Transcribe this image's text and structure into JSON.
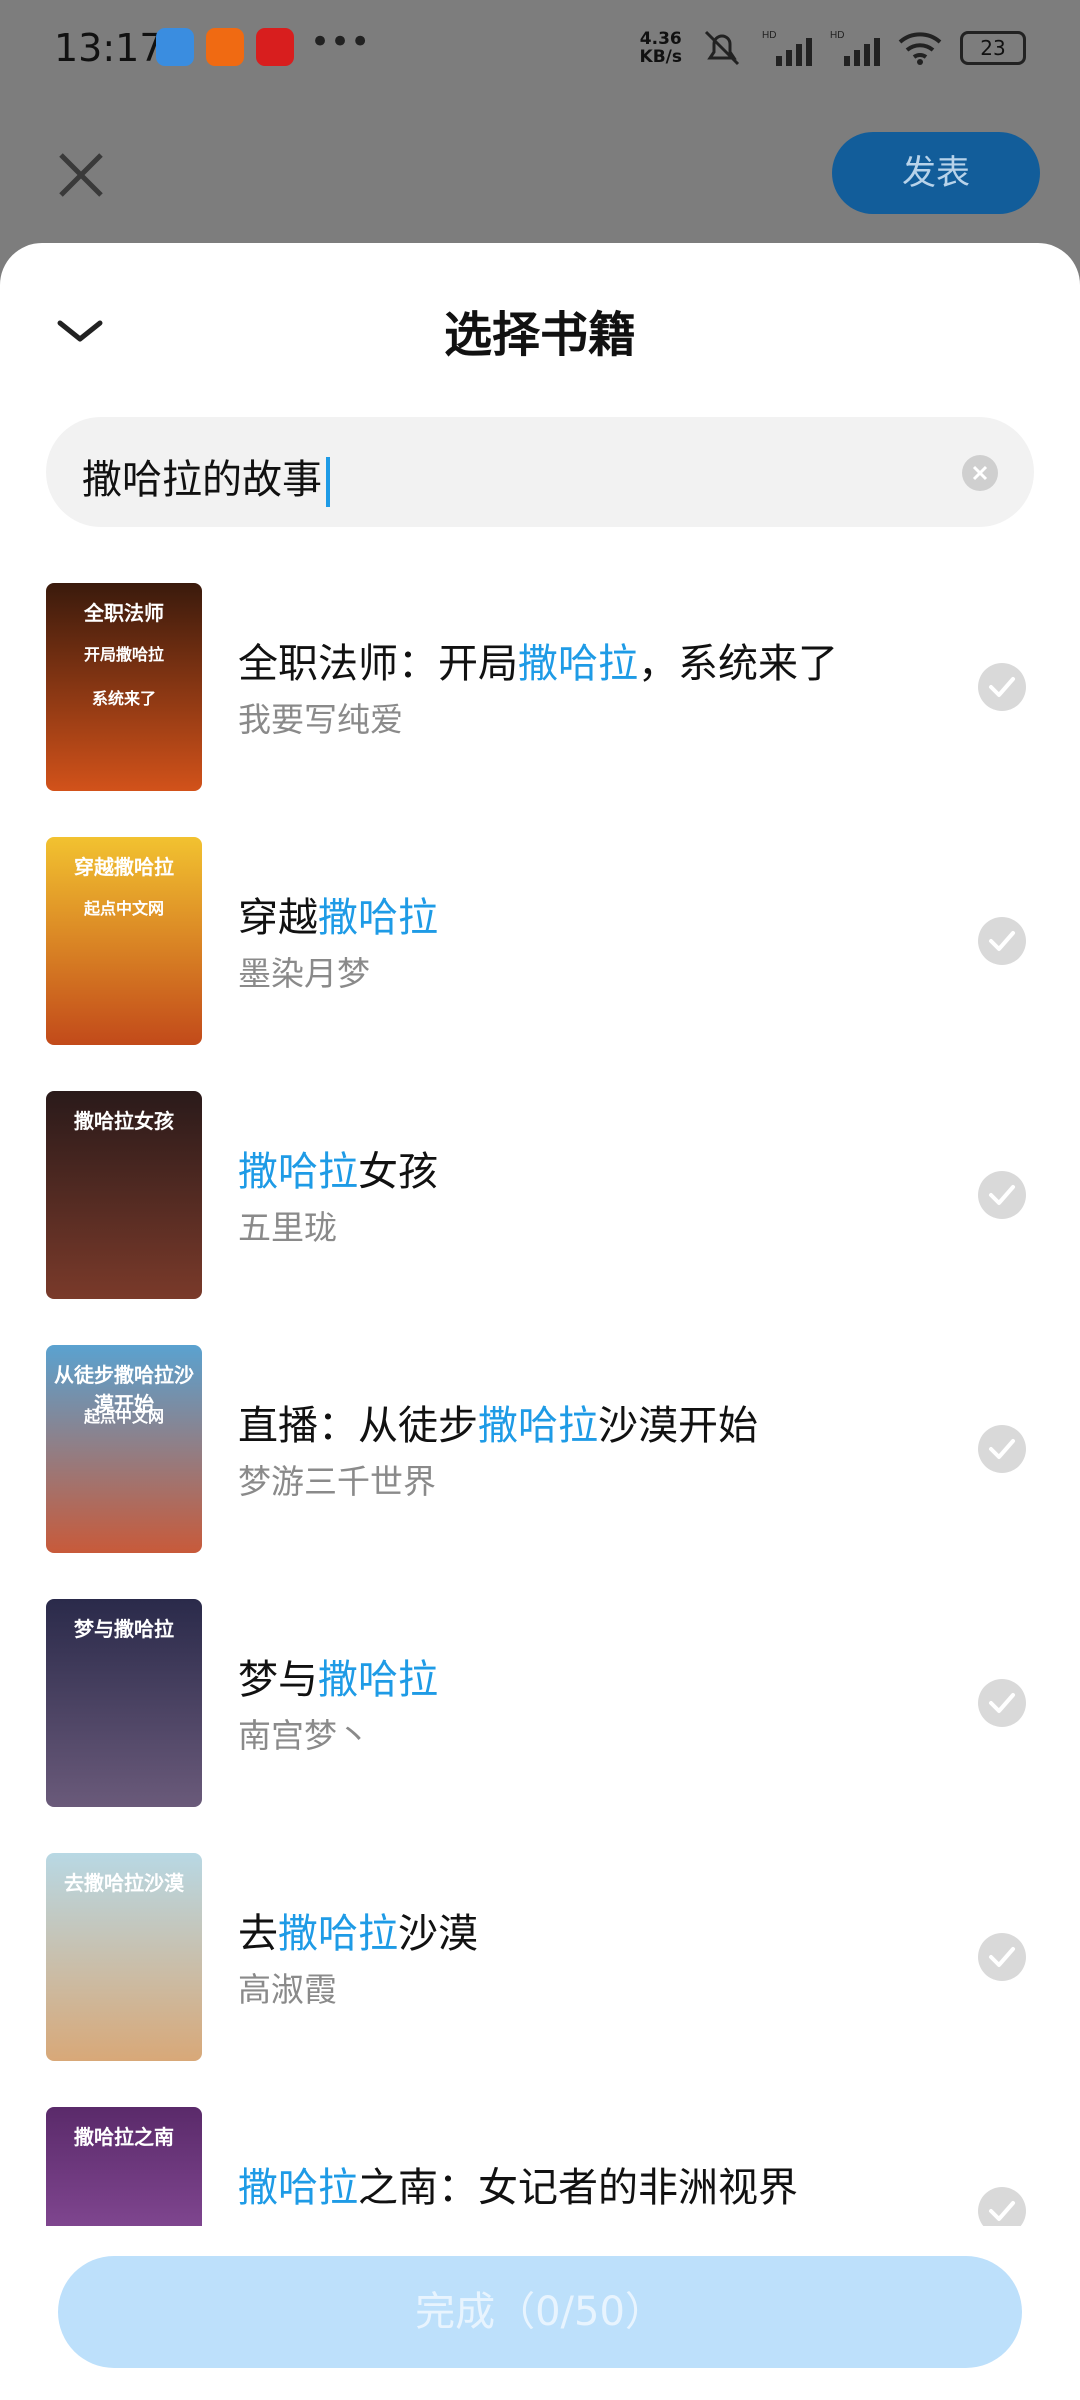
{
  "status_bar": {
    "time": "13:17",
    "net_speed_value": "4.36",
    "net_speed_unit": "KB/s",
    "battery": "23"
  },
  "header_behind": {
    "publish_label": "发表"
  },
  "sheet": {
    "title": "选择书籍",
    "search": {
      "value": "撒哈拉的故事"
    },
    "books": [
      {
        "title_parts": [
          "全职法师：开局",
          "撒哈拉",
          "，系统来了"
        ],
        "author": "我要写纯爱",
        "cover_text": [
          "全职法师",
          "开局撒哈拉",
          "系统来了"
        ],
        "cover_colors": [
          "#3a1a0c",
          "#d2521a"
        ]
      },
      {
        "title_parts": [
          "穿越",
          "撒哈拉",
          ""
        ],
        "author": "墨染月梦",
        "cover_text": [
          "穿越撒哈拉",
          "起点中文网"
        ],
        "cover_colors": [
          "#f2c230",
          "#c24a1a"
        ]
      },
      {
        "title_parts": [
          "",
          "撒哈拉",
          "女孩"
        ],
        "author": "五里珑",
        "cover_text": [
          "撒哈拉女孩"
        ],
        "cover_colors": [
          "#2a1a1a",
          "#7a3a2a"
        ]
      },
      {
        "title_parts": [
          "直播：从徒步",
          "撒哈拉",
          "沙漠开始"
        ],
        "author": "梦游三千世界",
        "cover_text": [
          "从徒步撒哈拉沙漠开始",
          "起点中文网"
        ],
        "cover_colors": [
          "#5aa2d0",
          "#c85a3a"
        ]
      },
      {
        "title_parts": [
          "梦与",
          "撒哈拉",
          ""
        ],
        "author": "南宫梦丶",
        "cover_text": [
          "梦与撒哈拉"
        ],
        "cover_colors": [
          "#2a2a4a",
          "#6a5a7a"
        ]
      },
      {
        "title_parts": [
          "去",
          "撒哈拉",
          "沙漠"
        ],
        "author": "高淑霞",
        "cover_text": [
          "去撒哈拉沙漠"
        ],
        "cover_colors": [
          "#b8d8e4",
          "#d8a878"
        ]
      },
      {
        "title_parts": [
          "",
          "撒哈拉",
          "之南：女记者的非洲视界"
        ],
        "author": "",
        "cover_text": [
          "撒哈拉之南"
        ],
        "cover_colors": [
          "#5a2a6a",
          "#9a5aaa"
        ]
      }
    ],
    "done_label": "完成（0/50）"
  }
}
